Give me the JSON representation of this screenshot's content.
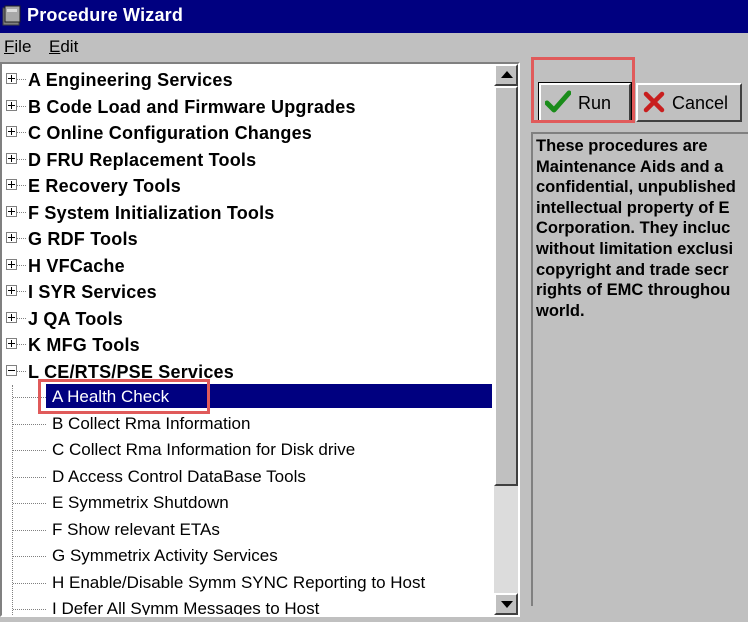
{
  "window": {
    "title": "Procedure Wizard",
    "title_icon": "window-app-icon"
  },
  "menu": {
    "file": "File",
    "file_key": "F",
    "file_rest": "ile",
    "edit": "Edit",
    "edit_key": "E",
    "edit_rest": "dit"
  },
  "tree": {
    "top_items": [
      {
        "label": "A Engineering Services",
        "state": "collapsed"
      },
      {
        "label": "B Code Load and Firmware Upgrades",
        "state": "collapsed"
      },
      {
        "label": "C Online Configuration Changes",
        "state": "collapsed"
      },
      {
        "label": "D FRU Replacement Tools",
        "state": "collapsed"
      },
      {
        "label": "E Recovery Tools",
        "state": "collapsed"
      },
      {
        "label": "F System Initialization Tools",
        "state": "collapsed"
      },
      {
        "label": "G RDF Tools",
        "state": "collapsed"
      },
      {
        "label": "H VFCache",
        "state": "collapsed"
      },
      {
        "label": "I SYR Services",
        "state": "collapsed"
      },
      {
        "label": "J QA Tools",
        "state": "collapsed"
      },
      {
        "label": "K MFG Tools",
        "state": "collapsed"
      },
      {
        "label": "L CE/RTS/PSE Services",
        "state": "expanded"
      }
    ],
    "children": [
      {
        "label": "A Health Check",
        "selected": true
      },
      {
        "label": "B Collect Rma Information"
      },
      {
        "label": "C Collect Rma Information for Disk drive"
      },
      {
        "label": "D Access Control DataBase Tools"
      },
      {
        "label": "E Symmetrix Shutdown"
      },
      {
        "label": "F Show relevant ETAs"
      },
      {
        "label": "G Symmetrix Activity Services"
      },
      {
        "label": "H Enable/Disable Symm SYNC Reporting to Host"
      },
      {
        "label": "I Defer All Symm Messages to Host"
      }
    ]
  },
  "buttons": {
    "run": {
      "label": "Run",
      "icon": "checkmark-icon",
      "icon_color": "#1a8c1a"
    },
    "cancel": {
      "label": "Cancel",
      "icon": "x-icon",
      "icon_color": "#c81e1e"
    }
  },
  "description": {
    "lines": [
      "These procedures are",
      "Maintenance Aids and a",
      "confidential, unpublished",
      "intellectual property of E",
      "Corporation. They incluc",
      "without limitation exclusi",
      "copyright and trade secr",
      "rights of EMC throughou",
      "world."
    ]
  },
  "colors": {
    "titlebar": "#000080",
    "selection": "#000080",
    "annotation": "#e05a5a"
  }
}
